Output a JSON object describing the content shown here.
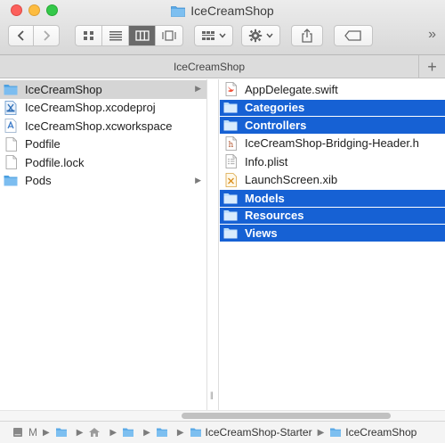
{
  "window": {
    "title": "IceCreamShop"
  },
  "pathbar_top": {
    "label": "IceCreamShop",
    "add_symbol": "+"
  },
  "toolbar": {
    "overflow_symbol": "»"
  },
  "column1": [
    {
      "name": "IceCreamShop",
      "icon": "folder-icon",
      "selected": true,
      "has_children": true
    },
    {
      "name": "IceCreamShop.xcodeproj",
      "icon": "xcodeproj-icon",
      "selected": false,
      "has_children": false
    },
    {
      "name": "IceCreamShop.xcworkspace",
      "icon": "xcworkspace-icon",
      "selected": false,
      "has_children": false
    },
    {
      "name": "Podfile",
      "icon": "document-icon",
      "selected": false,
      "has_children": false
    },
    {
      "name": "Podfile.lock",
      "icon": "document-icon",
      "selected": false,
      "has_children": false
    },
    {
      "name": "Pods",
      "icon": "folder-icon",
      "selected": false,
      "has_children": true
    }
  ],
  "column2": [
    {
      "name": "AppDelegate.swift",
      "icon": "swift-file-icon",
      "selected": false
    },
    {
      "name": "Categories",
      "icon": "folder-icon",
      "selected": true
    },
    {
      "name": "Controllers",
      "icon": "folder-icon",
      "selected": true
    },
    {
      "name": "IceCreamShop-Bridging-Header.h",
      "icon": "header-file-icon",
      "selected": false
    },
    {
      "name": "Info.plist",
      "icon": "plist-file-icon",
      "selected": false
    },
    {
      "name": "LaunchScreen.xib",
      "icon": "xib-file-icon",
      "selected": false
    },
    {
      "name": "Models",
      "icon": "folder-icon",
      "selected": true
    },
    {
      "name": "Resources",
      "icon": "folder-icon",
      "selected": true
    },
    {
      "name": "Views",
      "icon": "folder-icon",
      "selected": true
    }
  ],
  "pathbar_bottom": {
    "first_label": "M",
    "starter": "IceCreamShop-Starter",
    "current": "IceCreamShop"
  },
  "colors": {
    "selection_blue": "#1661d4",
    "selection_gray": "#d5d5d5",
    "folder_blue": "#5aa9e6"
  }
}
